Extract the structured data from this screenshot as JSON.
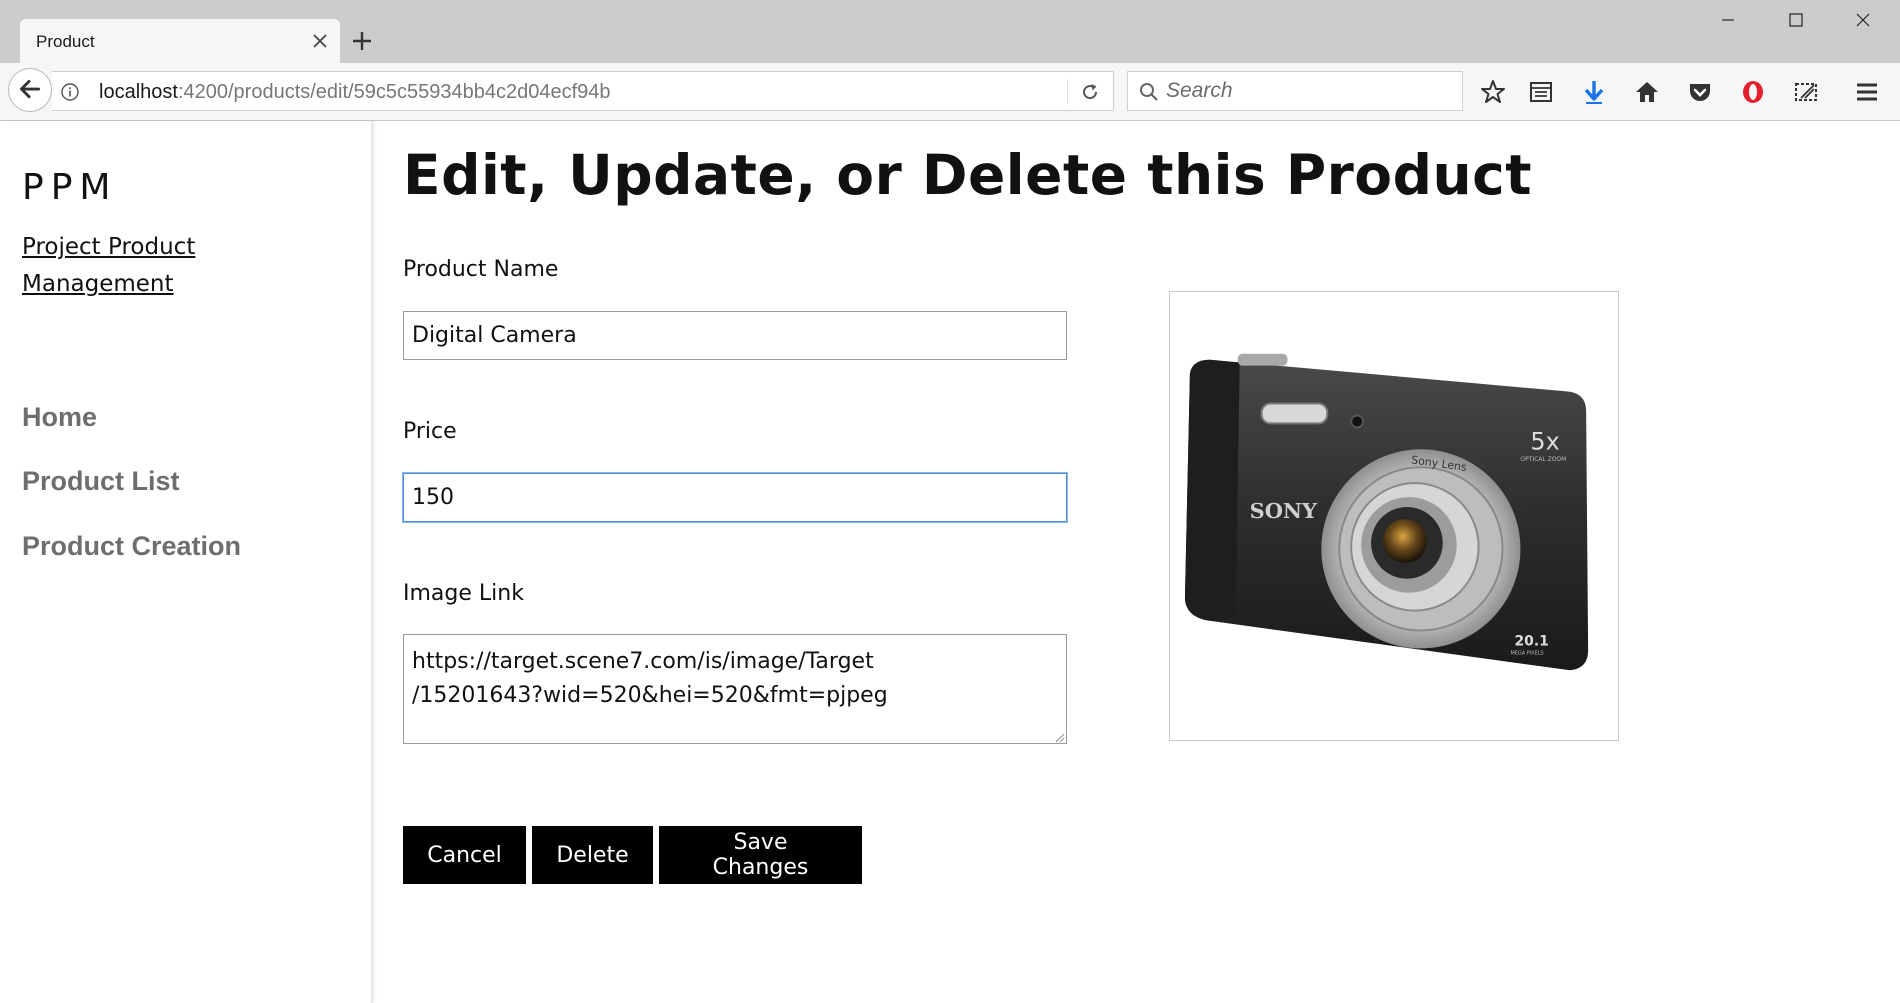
{
  "browser": {
    "tab_title": "Product",
    "url_host": "localhost",
    "url_path": ":4200/products/edit/59c5c55934bb4c2d04ecf94b",
    "search_placeholder": "Search"
  },
  "sidebar": {
    "brand": "PPM",
    "brand_subtitle": "Project Product Management",
    "nav": [
      {
        "label": "Home"
      },
      {
        "label": "Product List"
      },
      {
        "label": "Product Creation"
      }
    ]
  },
  "main": {
    "title": "Edit, Update, or Delete this Product",
    "fields": {
      "name_label": "Product Name",
      "name_value": "Digital Camera",
      "price_label": "Price",
      "price_value": "150",
      "image_label": "Image Link",
      "image_value": "https://target.scene7.com/is/image/Target\n/15201643?wid=520&hei=520&fmt=pjpeg"
    },
    "camera_brand": "SONY",
    "camera_lens": "Sony Lens",
    "camera_zoom": "5x",
    "camera_zoom_sub": "OPTICAL ZOOM",
    "camera_mp": "20.1",
    "camera_mp_sub": "MEGA PIXELS",
    "buttons": {
      "cancel": "Cancel",
      "delete": "Delete",
      "save": "Save Changes"
    }
  },
  "colors": {
    "download_icon": "#1a73e8",
    "opera_icon": "#e5202e",
    "focus_border": "#4a90d9"
  }
}
